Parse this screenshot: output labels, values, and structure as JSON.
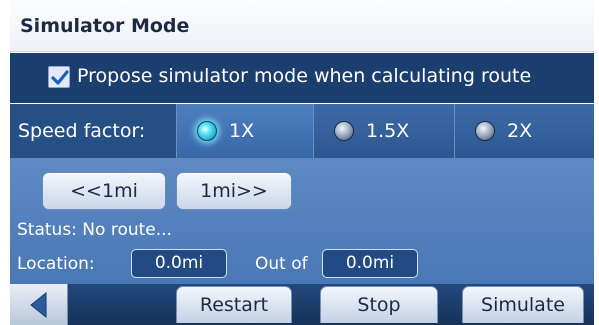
{
  "title": "Simulator Mode",
  "propose": {
    "label": "Propose simulator mode when calculating route",
    "checked": true
  },
  "speed": {
    "label": "Speed factor:",
    "options": [
      {
        "label": "1X",
        "selected": true
      },
      {
        "label": "1.5X",
        "selected": false
      },
      {
        "label": "2X",
        "selected": false
      }
    ]
  },
  "nav": {
    "back_step": "<<1mi",
    "forward_step": "1mi>>"
  },
  "status": {
    "text": "Status: No route..."
  },
  "location": {
    "label": "Location:",
    "value": "0.0mi",
    "out_of_label": "Out of",
    "total": "0.0mi"
  },
  "bottom": {
    "back_icon": "left-arrow-icon",
    "restart": "Restart",
    "stop": "Stop",
    "simulate": "Simulate"
  },
  "colors": {
    "header_dark": "#1c3e6f",
    "speed_row": "#264f86",
    "panel": "#5578b8",
    "selected_radio": "#57e2f0"
  }
}
